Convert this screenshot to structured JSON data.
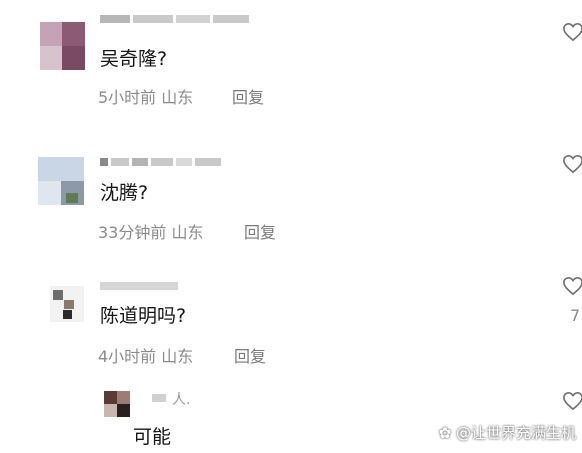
{
  "comments": [
    {
      "text": "吴奇隆?",
      "time": "5小时前",
      "location": "山东",
      "reply": "回复",
      "username_partial": ""
    },
    {
      "text": "沈腾?",
      "time": "33分钟前",
      "location": "山东",
      "reply": "回复"
    },
    {
      "text": "陈道明吗?",
      "time": "4小时前",
      "location": "山东",
      "reply": "回复",
      "like_count": "7"
    },
    {
      "text": "可能",
      "username_partial": "人."
    }
  ],
  "watermark": "@让世界充满生机",
  "icons": {
    "like": "heart-outline-icon",
    "watermark": "author-icon"
  }
}
